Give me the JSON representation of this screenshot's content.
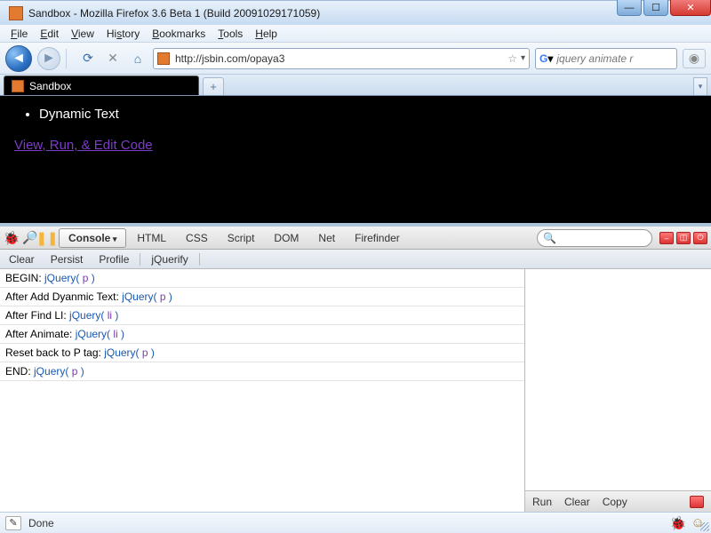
{
  "window": {
    "title": "Sandbox - Mozilla Firefox 3.6 Beta 1 (Build 20091029171059)"
  },
  "menubar": {
    "file": "File",
    "edit": "Edit",
    "view": "View",
    "history": "History",
    "bookmarks": "Bookmarks",
    "tools": "Tools",
    "help": "Help"
  },
  "toolbar": {
    "url": "http://jsbin.com/opaya3",
    "search_value": "jquery animate r"
  },
  "tabs": {
    "active": "Sandbox"
  },
  "page": {
    "list_item": "Dynamic Text",
    "link": "View, Run, & Edit Code"
  },
  "firebug": {
    "tabs": {
      "console": "Console",
      "html": "HTML",
      "css": "CSS",
      "script": "Script",
      "dom": "DOM",
      "net": "Net",
      "firefinder": "Firefinder"
    },
    "subtabs": {
      "clear": "Clear",
      "persist": "Persist",
      "profile": "Profile",
      "jquerify": "jQuerify"
    },
    "lines": [
      {
        "pre": "BEGIN: ",
        "fn": "jQuery(",
        "arg": " p ",
        "post": ")"
      },
      {
        "pre": "After Add Dyanmic Text: ",
        "fn": "jQuery(",
        "arg": " p ",
        "post": ")"
      },
      {
        "pre": "After Find LI: ",
        "fn": "jQuery(",
        "arg": " li ",
        "post": ")"
      },
      {
        "pre": "After Animate: ",
        "fn": "jQuery(",
        "arg": " li ",
        "post": ")"
      },
      {
        "pre": "Reset back to P tag: ",
        "fn": "jQuery(",
        "arg": " p ",
        "post": ")"
      },
      {
        "pre": "END: ",
        "fn": "jQuery(",
        "arg": " p ",
        "post": ")"
      }
    ],
    "cmdbar": {
      "run": "Run",
      "clear": "Clear",
      "copy": "Copy"
    }
  },
  "statusbar": {
    "text": "Done"
  }
}
